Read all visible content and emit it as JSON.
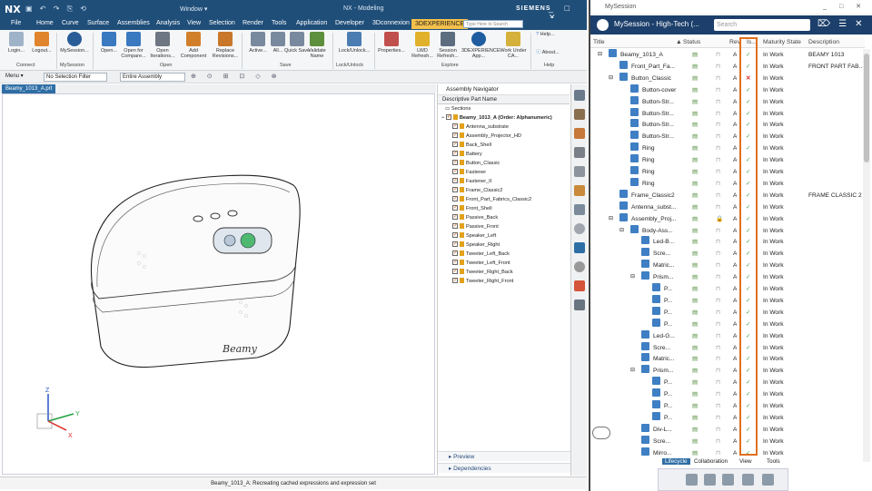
{
  "nx": {
    "logo": "NX",
    "window_menu": "Window ▾",
    "app_title": "NX - Modeling",
    "brand": "SIEMENS",
    "search_placeholder": "Type Here to Search",
    "menu": [
      "File",
      "Home",
      "Curve",
      "Surface",
      "Assemblies",
      "Analysis",
      "View",
      "Selection",
      "Render",
      "Tools",
      "Application",
      "Developer",
      "3Dconnexion",
      "3DEXPERIENCE"
    ],
    "ribbon_buttons": [
      "Login...",
      "Logout...",
      "MySession...",
      "Open...",
      "Open for Compare...",
      "Open Iterations...",
      "Add Component",
      "Replace Revisions...",
      "Active...",
      "All...",
      "Quick Save",
      "Validate Name",
      "Lock/Unlock...",
      "Properties...",
      "LWD Refresh...",
      "Session Refresh...",
      "3DEXPERIENCE App...",
      "Work Under CA...",
      "Help...",
      "About..."
    ],
    "ribbon_groups": [
      "Connect",
      "MySession",
      "Open",
      "Save",
      "Lock/Unlock",
      "Explore",
      "Help"
    ],
    "toolbar": {
      "menu": "Menu ▾",
      "filter": "No Selection Filter",
      "scope": "Entire Assembly"
    },
    "file_tab": "Beamy_1013_A.prt",
    "status": "Beamy_1013_A: Recreating cached expressions and expression set"
  },
  "navigator": {
    "title": "Assembly Navigator",
    "column": "Descriptive Part Name",
    "sections": "Sections",
    "root": "Beamy_1013_A (Order: Alphanumeric)",
    "items": [
      "Antenna_substrate",
      "Assembly_Projector_HD",
      "Back_Shell",
      "Battery",
      "Button_Classic",
      "Fastener",
      "Fastener_II",
      "Frame_Classic2",
      "Front_Part_Fabrics_Classic2",
      "Front_Shell",
      "Passive_Back",
      "Passive_Front",
      "Speaker_Left",
      "Speaker_Right",
      "Tweeter_Left_Back",
      "Tweeter_Left_Front",
      "Tweeter_Right_Back",
      "Tweeter_Right_Front"
    ],
    "footer": [
      "Preview",
      "Dependencies"
    ]
  },
  "mysession": {
    "window_title": "MySession",
    "session_name": "MySession - High-Tech (...",
    "search_placeholder": "Search",
    "columns": [
      "Title",
      "Status",
      "Rev",
      "Is...",
      "Maturity State",
      "Description"
    ],
    "rows": [
      {
        "title": "Beamy_1013_A",
        "rev": "A",
        "ok": true,
        "maturity": "In Work",
        "desc": "BEAMY 1013"
      },
      {
        "title": "Front_Part_Fa...",
        "rev": "A",
        "ok": true,
        "maturity": "In Work",
        "desc": "FRONT PART FAB..."
      },
      {
        "title": "Button_Classic",
        "rev": "A",
        "ok": false,
        "maturity": "In Work",
        "desc": ""
      },
      {
        "title": "Button-cover",
        "rev": "A",
        "ok": true,
        "maturity": "In Work",
        "desc": ""
      },
      {
        "title": "Button-Str...",
        "rev": "A",
        "ok": true,
        "maturity": "In Work",
        "desc": ""
      },
      {
        "title": "Button-Str...",
        "rev": "A",
        "ok": true,
        "maturity": "In Work",
        "desc": ""
      },
      {
        "title": "Button-Str...",
        "rev": "A",
        "ok": true,
        "maturity": "In Work",
        "desc": ""
      },
      {
        "title": "Button-Str...",
        "rev": "A",
        "ok": true,
        "maturity": "In Work",
        "desc": ""
      },
      {
        "title": "Ring",
        "rev": "A",
        "ok": true,
        "maturity": "In Work",
        "desc": ""
      },
      {
        "title": "Ring",
        "rev": "A",
        "ok": true,
        "maturity": "In Work",
        "desc": ""
      },
      {
        "title": "Ring",
        "rev": "A",
        "ok": true,
        "maturity": "In Work",
        "desc": ""
      },
      {
        "title": "Ring",
        "rev": "A",
        "ok": true,
        "maturity": "In Work",
        "desc": ""
      },
      {
        "title": "Frame_Classic2",
        "rev": "A",
        "ok": true,
        "maturity": "In Work",
        "desc": "FRAME CLASSIC 2"
      },
      {
        "title": "Antenna_subst...",
        "rev": "A",
        "ok": true,
        "maturity": "In Work",
        "desc": ""
      },
      {
        "title": "Assembly_Proj...",
        "rev": "A",
        "ok": true,
        "maturity": "In Work",
        "desc": ""
      },
      {
        "title": "Body-Ass...",
        "rev": "A",
        "ok": true,
        "maturity": "In Work",
        "desc": ""
      },
      {
        "title": "Led-B...",
        "rev": "A",
        "ok": true,
        "maturity": "In Work",
        "desc": ""
      },
      {
        "title": "Scre...",
        "rev": "A",
        "ok": true,
        "maturity": "In Work",
        "desc": ""
      },
      {
        "title": "Matric...",
        "rev": "A",
        "ok": true,
        "maturity": "In Work",
        "desc": ""
      },
      {
        "title": "Prism...",
        "rev": "A",
        "ok": true,
        "maturity": "In Work",
        "desc": ""
      },
      {
        "title": "P...",
        "rev": "A",
        "ok": true,
        "maturity": "In Work",
        "desc": ""
      },
      {
        "title": "P...",
        "rev": "A",
        "ok": true,
        "maturity": "In Work",
        "desc": ""
      },
      {
        "title": "P...",
        "rev": "A",
        "ok": true,
        "maturity": "In Work",
        "desc": ""
      },
      {
        "title": "P...",
        "rev": "A",
        "ok": true,
        "maturity": "In Work",
        "desc": ""
      },
      {
        "title": "Led-G...",
        "rev": "A",
        "ok": true,
        "maturity": "In Work",
        "desc": ""
      },
      {
        "title": "Scre...",
        "rev": "A",
        "ok": true,
        "maturity": "In Work",
        "desc": ""
      },
      {
        "title": "Matric...",
        "rev": "A",
        "ok": true,
        "maturity": "In Work",
        "desc": ""
      },
      {
        "title": "Prism...",
        "rev": "A",
        "ok": true,
        "maturity": "In Work",
        "desc": ""
      },
      {
        "title": "P...",
        "rev": "A",
        "ok": true,
        "maturity": "In Work",
        "desc": ""
      },
      {
        "title": "P...",
        "rev": "A",
        "ok": true,
        "maturity": "In Work",
        "desc": ""
      },
      {
        "title": "P...",
        "rev": "A",
        "ok": true,
        "maturity": "In Work",
        "desc": ""
      },
      {
        "title": "P...",
        "rev": "A",
        "ok": true,
        "maturity": "In Work",
        "desc": ""
      },
      {
        "title": "Div-L...",
        "rev": "A",
        "ok": true,
        "maturity": "In Work",
        "desc": ""
      },
      {
        "title": "Scre...",
        "rev": "A",
        "ok": true,
        "maturity": "In Work",
        "desc": ""
      },
      {
        "title": "Mirro...",
        "rev": "A",
        "ok": true,
        "maturity": "In Work",
        "desc": ""
      }
    ],
    "bottom_tabs": [
      "Lifecycle",
      "Collaboration",
      "View",
      "Tools"
    ]
  },
  "colors": {
    "nx_blue": "#1f4e79",
    "session_blue": "#1c3f6b",
    "highlight": "#e0701f",
    "check": "#45a049",
    "cross": "#d9261c"
  }
}
